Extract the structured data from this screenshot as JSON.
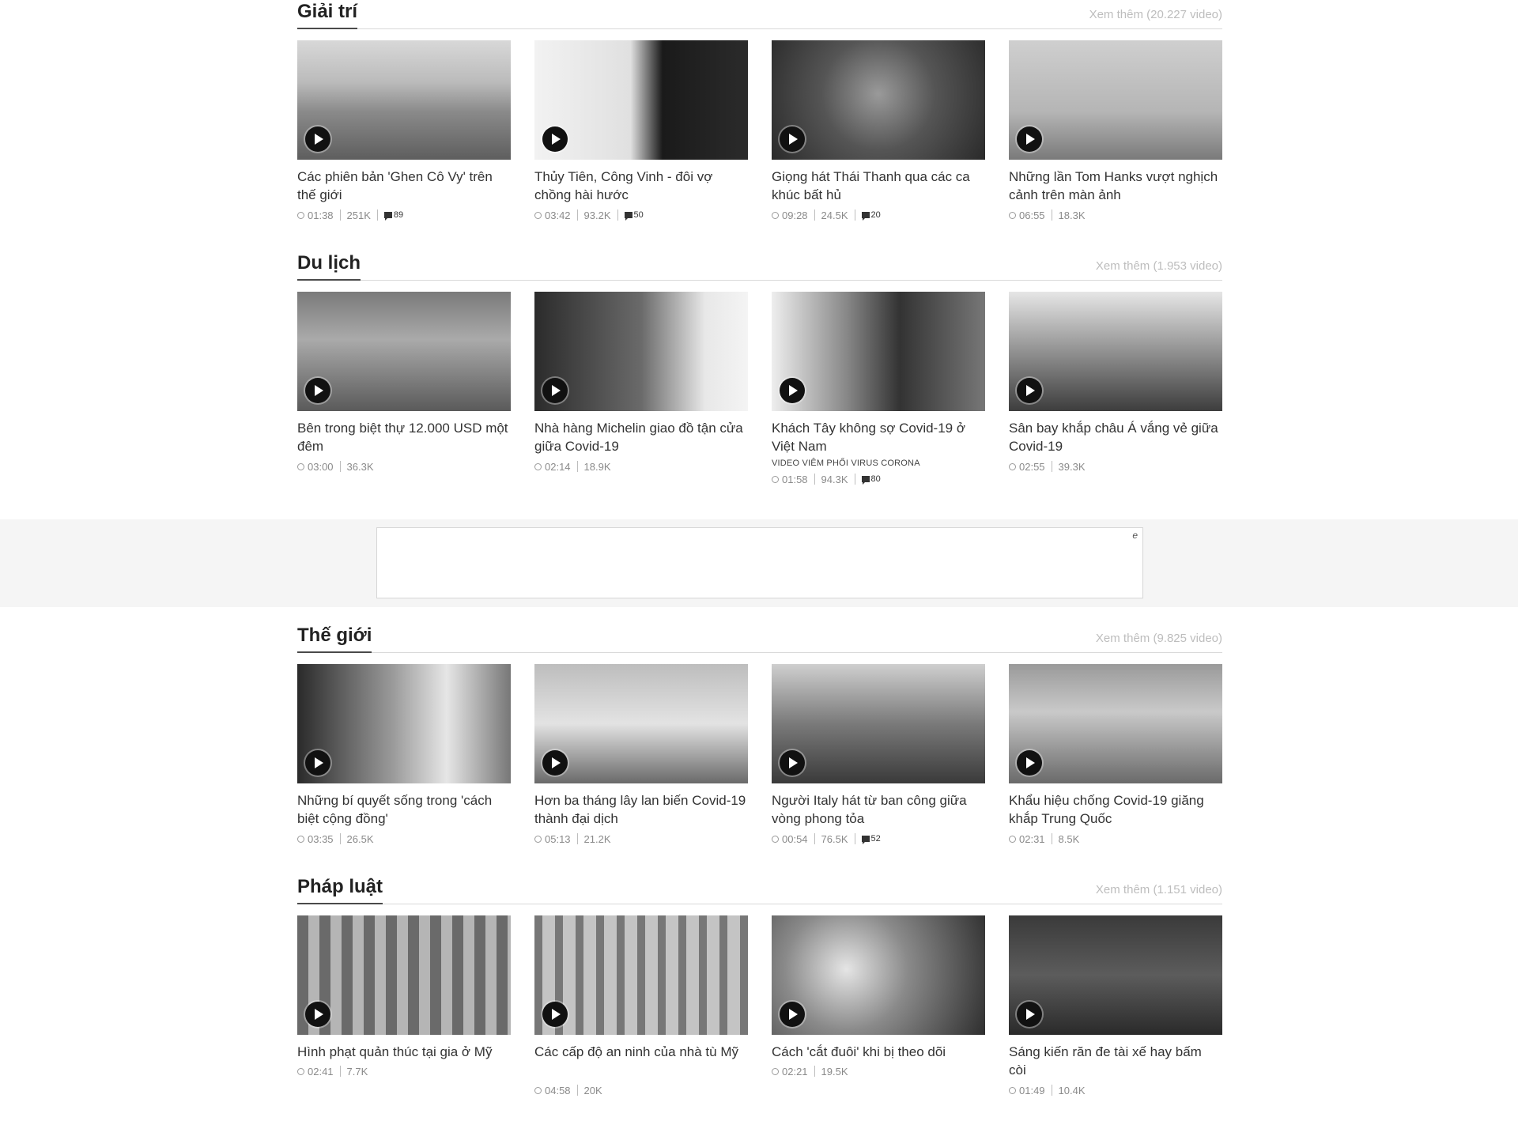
{
  "sections": [
    {
      "title": "Giải trí",
      "more": "Xem thêm (20.227 video)",
      "videos": [
        {
          "title": "Các phiên bản 'Ghen Cô Vy' trên thế giới",
          "duration": "01:38",
          "views": "251K",
          "comments": "89"
        },
        {
          "title": "Thủy Tiên, Công Vinh - đôi vợ chồng hài hước",
          "duration": "03:42",
          "views": "93.2K",
          "comments": "50"
        },
        {
          "title": "Giọng hát Thái Thanh qua các ca khúc bất hủ",
          "duration": "09:28",
          "views": "24.5K",
          "comments": "20"
        },
        {
          "title": "Những lần Tom Hanks vượt nghịch cảnh trên màn ảnh",
          "duration": "06:55",
          "views": "18.3K"
        }
      ]
    },
    {
      "title": "Du lịch",
      "more": "Xem thêm (1.953 video)",
      "videos": [
        {
          "title": "Bên trong biệt thự 12.000 USD một đêm",
          "duration": "03:00",
          "views": "36.3K"
        },
        {
          "title": "Nhà hàng Michelin giao đồ tận cửa giữa Covid-19",
          "duration": "02:14",
          "views": "18.9K"
        },
        {
          "title": "Khách Tây không sợ Covid-19 ở Việt Nam",
          "tag": "VIDEO VIÊM PHỔI VIRUS CORONA",
          "duration": "01:58",
          "views": "94.3K",
          "comments": "80"
        },
        {
          "title": "Sân bay khắp châu Á vắng vẻ giữa Covid-19",
          "duration": "02:55",
          "views": "39.3K"
        }
      ]
    },
    {
      "title": "Thế giới",
      "more": "Xem thêm (9.825 video)",
      "videos": [
        {
          "title": "Những bí quyết sống trong 'cách biệt cộng đồng'",
          "duration": "03:35",
          "views": "26.5K"
        },
        {
          "title": "Hơn ba tháng lây lan biến Covid-19 thành đại dịch",
          "duration": "05:13",
          "views": "21.2K"
        },
        {
          "title": "Người Italy hát từ ban công giữa vòng phong tỏa",
          "duration": "00:54",
          "views": "76.5K",
          "comments": "52"
        },
        {
          "title": "Khẩu hiệu chống Covid-19 giăng khắp Trung Quốc",
          "duration": "02:31",
          "views": "8.5K"
        }
      ]
    },
    {
      "title": "Pháp luật",
      "more": "Xem thêm (1.151 video)",
      "videos": [
        {
          "title": "Hình phạt quản thúc tại gia ở Mỹ",
          "duration": "02:41",
          "views": "7.7K"
        },
        {
          "title": "Các cấp độ an ninh của nhà tù Mỹ",
          "duration": "04:58",
          "views": "20K"
        },
        {
          "title": "Cách 'cắt đuôi' khi bị theo dõi",
          "duration": "02:21",
          "views": "19.5K"
        },
        {
          "title": "Sáng kiến răn đe tài xế hay bấm còi",
          "duration": "01:49",
          "views": "10.4K"
        }
      ]
    }
  ],
  "ad": {
    "mark": "e"
  }
}
